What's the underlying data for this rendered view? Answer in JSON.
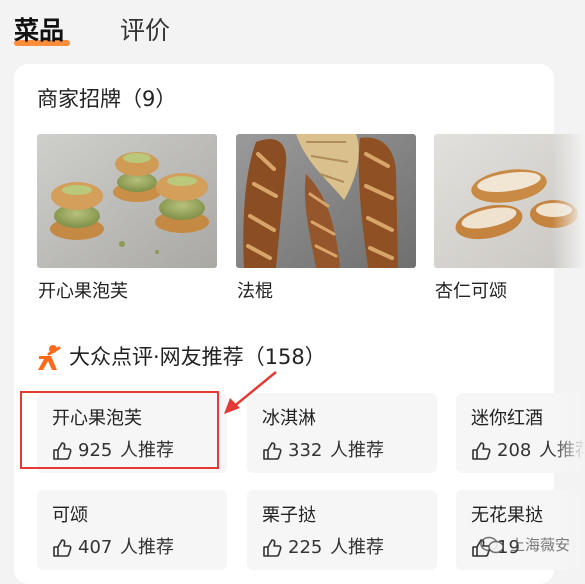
{
  "tabs": [
    {
      "label": "菜品",
      "active": true
    },
    {
      "label": "评价",
      "active": false
    }
  ],
  "signature": {
    "title": "商家招牌（9）",
    "dishes": [
      {
        "name": "开心果泡芙",
        "image": "pistachio-puffs"
      },
      {
        "name": "法棍",
        "image": "baguettes"
      },
      {
        "name": "杏仁可颂",
        "image": "almond-croissants"
      }
    ]
  },
  "recommendations": {
    "title": "大众点评·网友推荐（158）",
    "logo": "dianping-icon",
    "thumb_icon": "thumbs-up-icon",
    "unit": "人推荐",
    "items": [
      {
        "name": "开心果泡芙",
        "count": "925"
      },
      {
        "name": "冰淇淋",
        "count": "332"
      },
      {
        "name": "迷你红酒",
        "count": "208"
      },
      {
        "name": "可颂",
        "count": "407"
      },
      {
        "name": "栗子挞",
        "count": "225"
      },
      {
        "name": "无花果挞",
        "count": "19"
      }
    ]
  },
  "annotation": {
    "color": "#e53935"
  },
  "watermark": {
    "text": "上海薇安",
    "icon": "wechat-icon"
  },
  "colors": {
    "accent": "#ff7a1a",
    "card": "#ffffff",
    "page": "#f3f3f3"
  }
}
